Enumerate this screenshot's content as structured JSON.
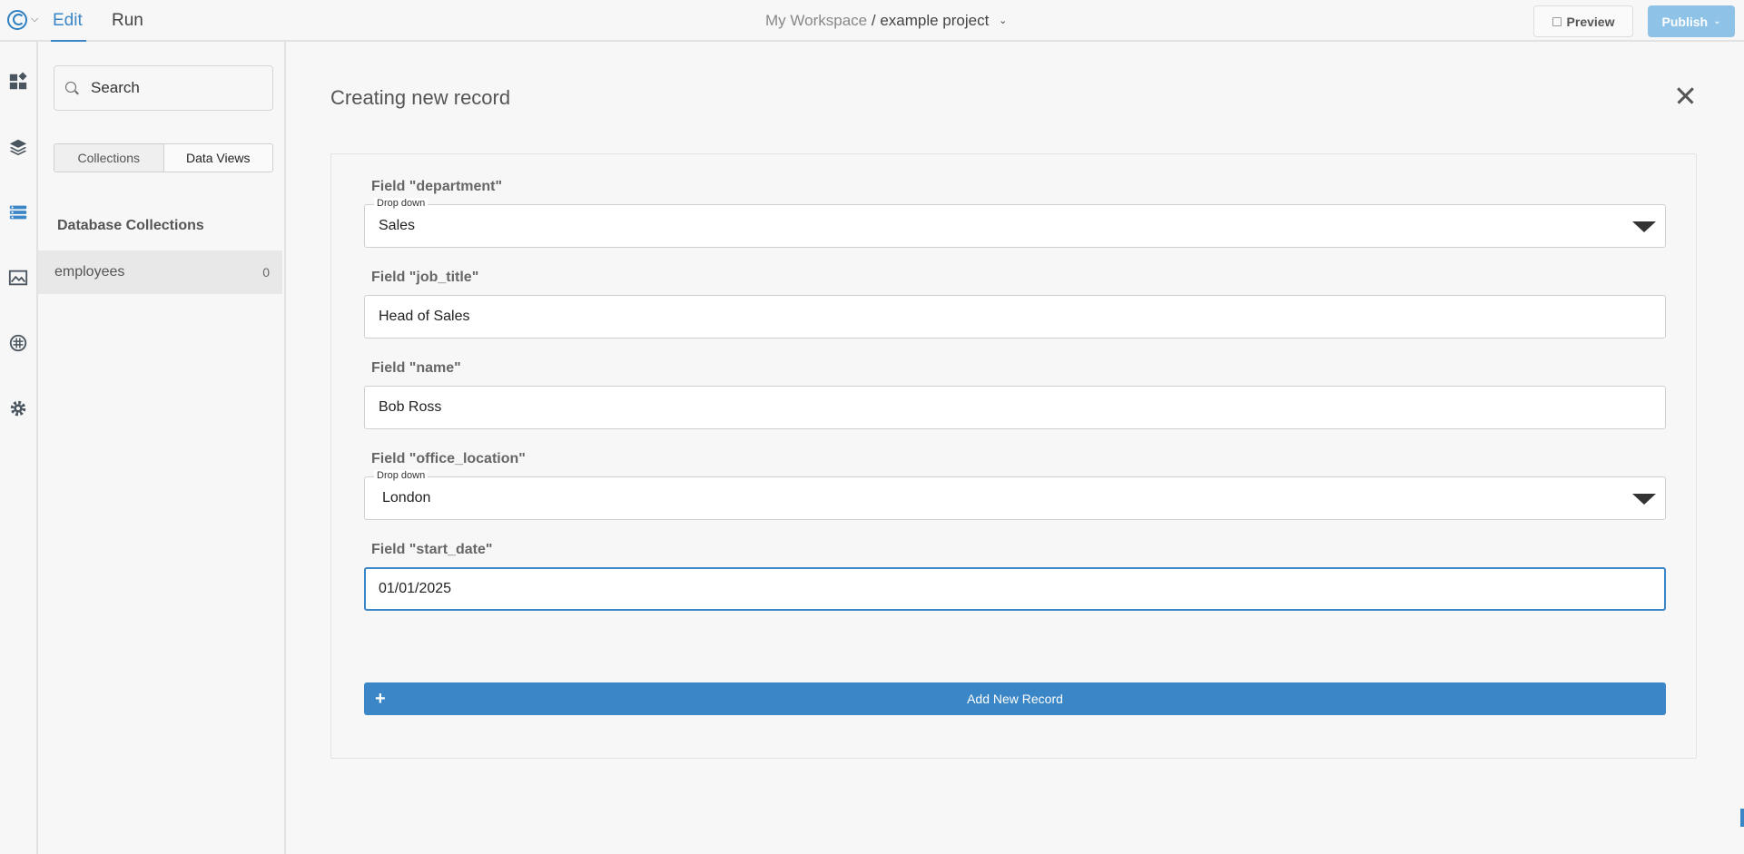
{
  "topbar": {
    "tabs": [
      {
        "label": "Edit",
        "active": true
      },
      {
        "label": "Run",
        "active": false
      }
    ],
    "breadcrumb": {
      "workspace": "My Workspace",
      "separator": "/",
      "project": "example project"
    },
    "preview_label": "Preview",
    "publish_label": "Publish"
  },
  "rail": {
    "icons": [
      "dashboard-icon",
      "layers-icon",
      "database-icon",
      "image-icon",
      "api-icon",
      "gear-icon"
    ],
    "active": "database-icon"
  },
  "sidebar": {
    "search": {
      "placeholder": "Search",
      "value": ""
    },
    "segments": [
      {
        "label": "Collections",
        "active": false
      },
      {
        "label": "Data Views",
        "active": true
      }
    ],
    "section_title": "Database Collections",
    "collections": [
      {
        "name": "employees",
        "count": "0"
      }
    ]
  },
  "main": {
    "title": "Creating new record",
    "fields": [
      {
        "label": "Field \"department\"",
        "type": "dropdown",
        "legend": "Drop down",
        "value": "Sales"
      },
      {
        "label": "Field \"job_title\"",
        "type": "text",
        "value": "Head of Sales"
      },
      {
        "label": "Field \"name\"",
        "type": "text",
        "value": "Bob Ross"
      },
      {
        "label": "Field \"office_location\"",
        "type": "dropdown",
        "legend": "Drop down",
        "value": "London"
      },
      {
        "label": "Field \"start_date\"",
        "type": "text",
        "value": "01/01/2025",
        "focused": true
      }
    ],
    "submit_label": "Add New Record"
  },
  "colors": {
    "accent": "#3a86c6",
    "publish": "#8ec2e6"
  }
}
